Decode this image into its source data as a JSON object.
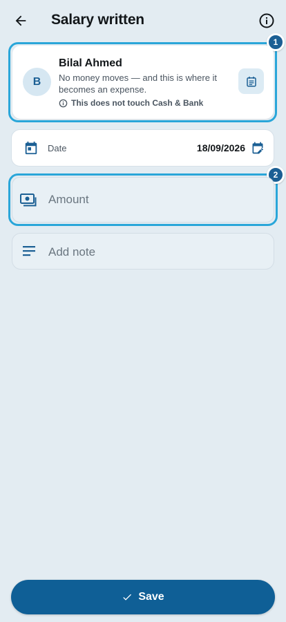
{
  "header": {
    "title": "Salary written",
    "back_icon": "arrow-left-icon",
    "info_icon": "info-circle-icon"
  },
  "person": {
    "avatar_initial": "B",
    "name": "Bilal Ahmed",
    "description": "No money moves — and this is where it becomes an expense.",
    "note": "This does not touch Cash & Bank",
    "note_icon": "info-outline-icon",
    "action_icon": "calendar-list-icon"
  },
  "date": {
    "label": "Date",
    "value": "18/09/2026",
    "icon": "calendar-icon",
    "edit_icon": "calendar-edit-icon"
  },
  "amount": {
    "placeholder": "Amount",
    "value": "",
    "icon": "cash-icon"
  },
  "note": {
    "placeholder": "Add note",
    "value": "",
    "icon": "notes-icon"
  },
  "badges": [
    "1",
    "2"
  ],
  "save": {
    "label": "Save",
    "icon": "check-icon"
  },
  "colors": {
    "background": "#e3ecf2",
    "primary": "#0f5f96",
    "highlight": "#2aa6d9",
    "badge": "#1b5f94"
  }
}
